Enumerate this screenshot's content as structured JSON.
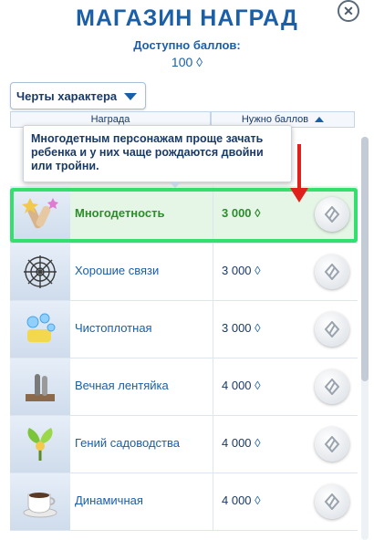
{
  "header": {
    "title": "МАГАЗИН НАГРАД",
    "points_label": "Доступно баллов:",
    "points_value": "100",
    "points_symbol": "◊"
  },
  "filter": {
    "selected": "Черты характера"
  },
  "columns": {
    "reward": "Награда",
    "cost": "Нужно баллов"
  },
  "tooltip": {
    "text": "Многодетным персонажам проще зачать ребенка и у них чаще рождаются двойни или тройни."
  },
  "rewards": [
    {
      "name": "Многодетность",
      "cost": "3 000",
      "icon": "fertility-icon",
      "selected": true
    },
    {
      "name": "Хорошие связи",
      "cost": "3 000",
      "icon": "web-icon",
      "selected": false
    },
    {
      "name": "Чистоплотная",
      "cost": "3 000",
      "icon": "bubbles-icon",
      "selected": false
    },
    {
      "name": "Вечная лентяйка",
      "cost": "4 000",
      "icon": "lazy-icon",
      "selected": false
    },
    {
      "name": "Гений садоводства",
      "cost": "4 000",
      "icon": "leaf-icon",
      "selected": false
    },
    {
      "name": "Динамичная",
      "cost": "4 000",
      "icon": "coffee-icon",
      "selected": false
    }
  ],
  "colors": {
    "accent": "#1a5fa8",
    "highlight": "#33e06e",
    "pointer": "#e0201a",
    "selected_text": "#2e8b2e"
  }
}
